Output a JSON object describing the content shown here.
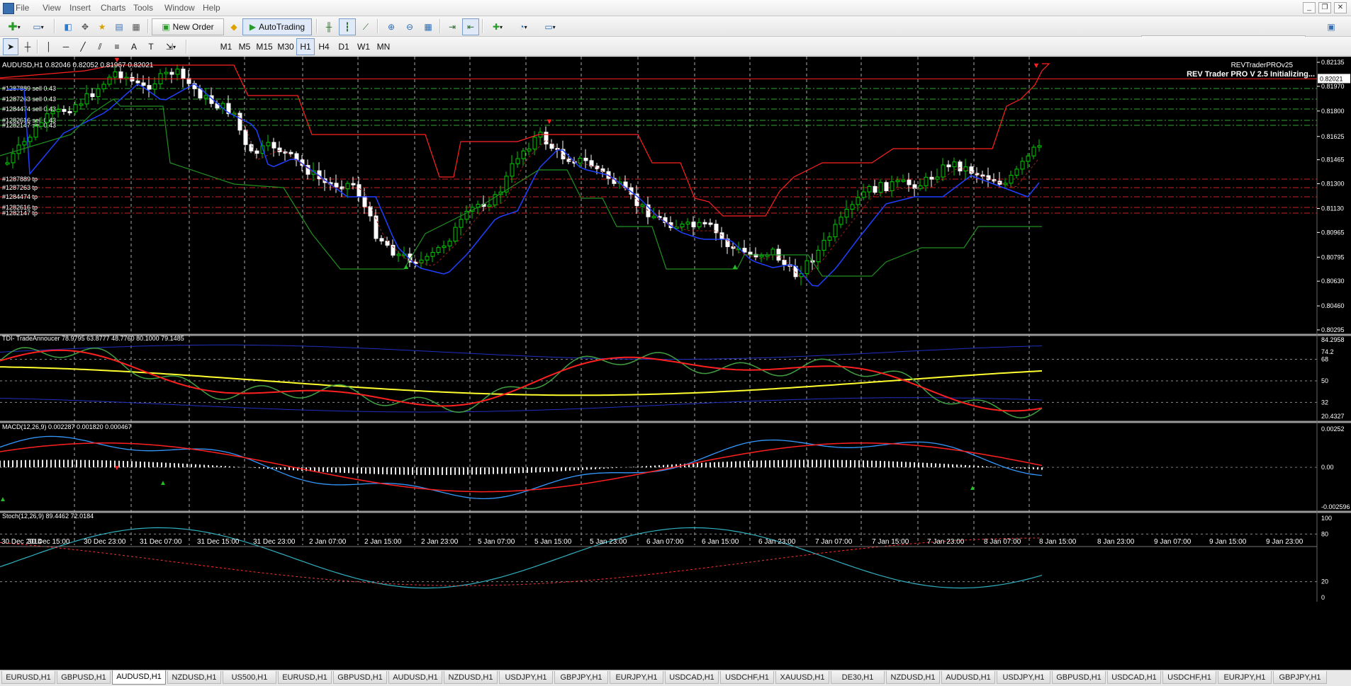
{
  "menu": [
    "File",
    "View",
    "Insert",
    "Charts",
    "Tools",
    "Window",
    "Help"
  ],
  "toolbar": {
    "new_order": "New Order",
    "autotrading": "AutoTrading",
    "timeframes": [
      "M1",
      "M5",
      "M15",
      "M30",
      "H1",
      "H4",
      "D1",
      "W1",
      "MN"
    ],
    "active_timeframe": "H1"
  },
  "chart": {
    "header": "AUDUSD,H1  0.82046 0.82052 0.81967 0.82021",
    "ea_name": "REVTraderPROv25",
    "ea_status": "REV Trader PRO V 2.5 Initializing...",
    "current_price": "0.82021",
    "price_ticks": [
      "0.82135",
      "0.81970",
      "0.81800",
      "0.81625",
      "0.81465",
      "0.81300",
      "0.81130",
      "0.80965",
      "0.80795",
      "0.80630",
      "0.80460",
      "0.80295"
    ],
    "orders_sell": [
      "#1287889 sell 0.43",
      "#1287263 sell 0.43",
      "#1284474 sell 0.43",
      "#1282616 sell 0.43",
      "#1282147 sell 0.43"
    ],
    "orders_tp": [
      "#1287889 tp",
      "#1287263 tp",
      "#1284474 tp",
      "#1282616 tp",
      "#1282147 tp"
    ],
    "time_labels": [
      "30 Dec 2014",
      "30 Dec 15:00",
      "30 Dec 23:00",
      "31 Dec 07:00",
      "31 Dec 15:00",
      "31 Dec 23:00",
      "2 Jan 07:00",
      "2 Jan 15:00",
      "2 Jan 23:00",
      "5 Jan 07:00",
      "5 Jan 15:00",
      "5 Jan 23:00",
      "6 Jan 07:00",
      "6 Jan 15:00",
      "6 Jan 23:00",
      "7 Jan 07:00",
      "7 Jan 15:00",
      "7 Jan 23:00",
      "8 Jan 07:00",
      "8 Jan 15:00",
      "8 Jan 23:00",
      "9 Jan 07:00",
      "9 Jan 15:00",
      "9 Jan 23:00"
    ]
  },
  "tdi": {
    "header": "TDI- TradeAnnoucer 78.9795 63.8777 48.7760 80.1000 79.1485",
    "ticks": [
      "84.2958",
      "74.2",
      "68",
      "50",
      "32",
      "20.4327"
    ]
  },
  "macd": {
    "header": "MACD(12,26,9) 0.002287 0.001820 0.000467",
    "ticks": [
      "0.00252",
      "0.00",
      "-0.002596"
    ]
  },
  "stoch": {
    "header": "Stoch(12,26,9) 89.4462 72.0184",
    "ticks": [
      "100",
      "80",
      "20",
      "0"
    ]
  },
  "tabs": [
    "EURUSD,H1",
    "GBPUSD,H1",
    "AUDUSD,H1",
    "NZDUSD,H1",
    "US500,H1",
    "EURUSD,H1",
    "GBPUSD,H1",
    "AUDUSD,H1",
    "NZDUSD,H1",
    "USDJPY,H1",
    "GBPJPY,H1",
    "EURJPY,H1",
    "USDCAD,H1",
    "USDCHF,H1",
    "XAUUSD,H1",
    "DE30,H1",
    "NZDUSD,H1",
    "AUDUSD,H1",
    "USDJPY,H1",
    "GBPUSD,H1",
    "USDCAD,H1",
    "USDCHF,H1",
    "EURJPY,H1",
    "GBPJPY,H1"
  ],
  "active_tab": "AUDUSD,H1",
  "colors": {
    "background": "#000000",
    "bull_candle": "#00cc00",
    "bear_candle": "#ffffff",
    "upper_band": "#ff2020",
    "lower_band": "#209020",
    "ma": "#2040ff",
    "tdi_price": "#ff2020",
    "tdi_signal": "#ffff30",
    "tdi_rsi": "#40a040",
    "macd_line": "#3399ff",
    "macd_signal": "#ff2020",
    "stoch_main": "#30b0c0",
    "stoch_signal": "#ff3030"
  }
}
